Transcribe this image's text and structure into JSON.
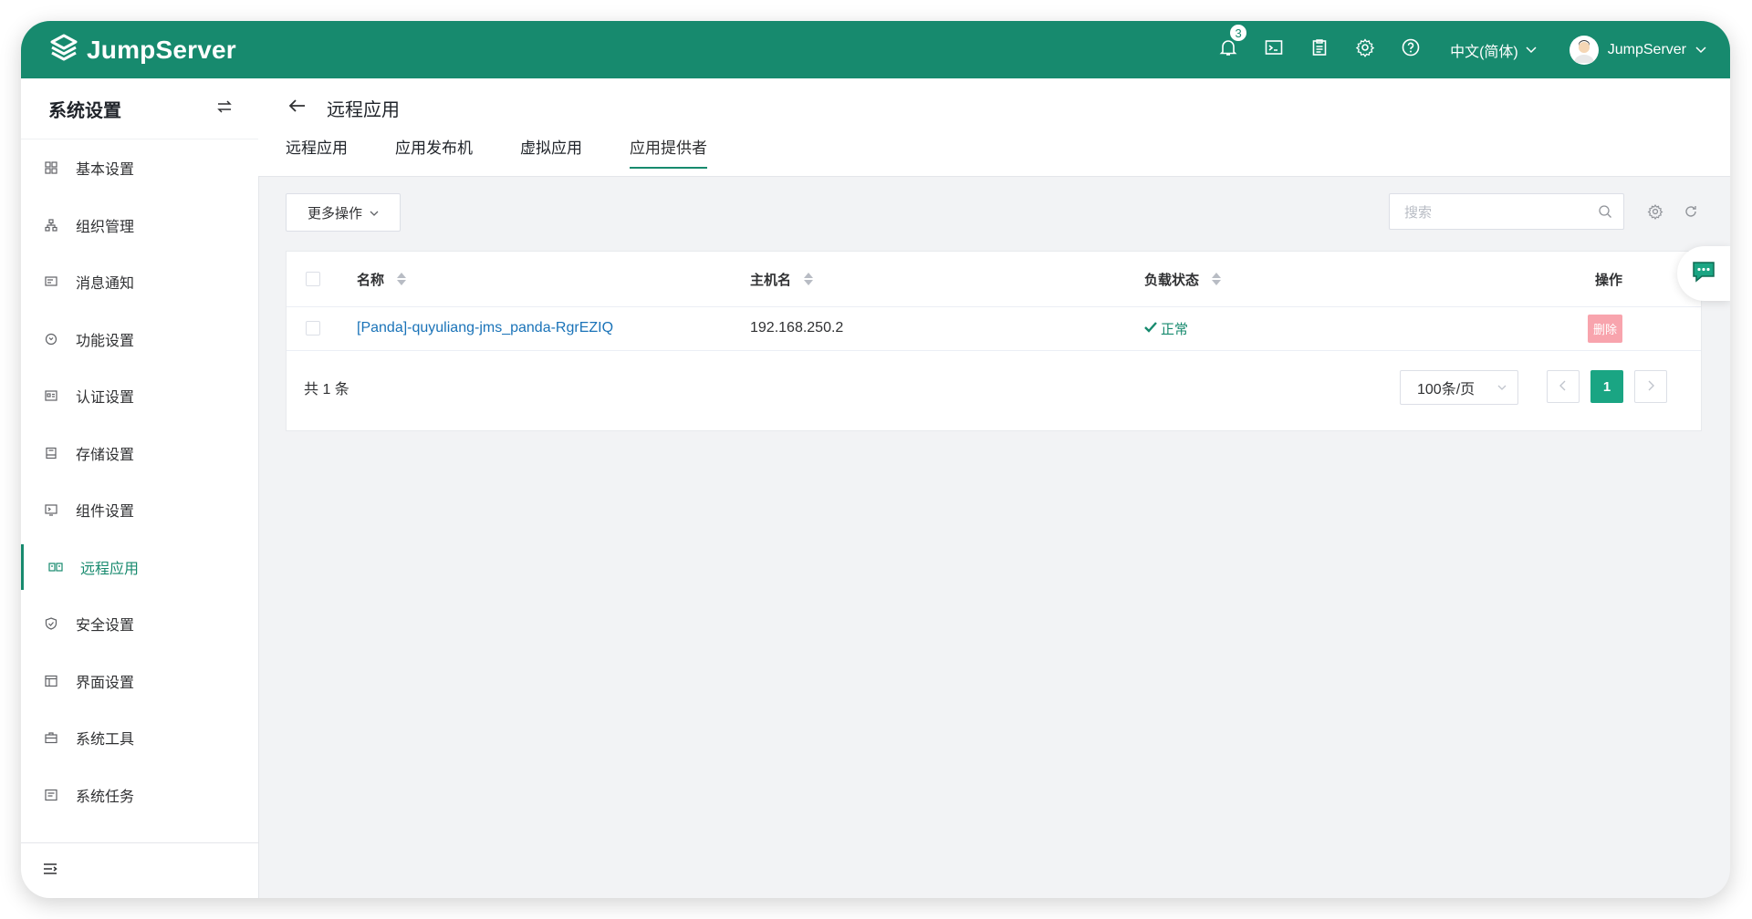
{
  "header": {
    "logo_text": "JumpServer",
    "notification_count": "3",
    "language": "中文(简体)",
    "username": "JumpServer",
    "icons": [
      "bell-icon",
      "terminal-icon",
      "clipboard-icon",
      "gear-icon",
      "help-icon"
    ],
    "bg_color": "#178a6e"
  },
  "sidebar": {
    "title": "系统设置",
    "items": [
      {
        "label": "基本设置",
        "icon": "grid-icon"
      },
      {
        "label": "组织管理",
        "icon": "org-icon"
      },
      {
        "label": "消息通知",
        "icon": "message-icon"
      },
      {
        "label": "功能设置",
        "icon": "feature-icon"
      },
      {
        "label": "认证设置",
        "icon": "id-card-icon"
      },
      {
        "label": "存储设置",
        "icon": "storage-icon"
      },
      {
        "label": "组件设置",
        "icon": "component-icon"
      },
      {
        "label": "远程应用",
        "icon": "remote-app-icon",
        "active": true
      },
      {
        "label": "安全设置",
        "icon": "shield-icon"
      },
      {
        "label": "界面设置",
        "icon": "interface-icon"
      },
      {
        "label": "系统工具",
        "icon": "toolbox-icon"
      },
      {
        "label": "系统任务",
        "icon": "task-icon"
      }
    ]
  },
  "page": {
    "title": "远程应用",
    "tabs": [
      "远程应用",
      "应用发布机",
      "虚拟应用",
      "应用提供者"
    ],
    "active_tab": "应用提供者"
  },
  "toolbar": {
    "more_actions": "更多操作",
    "search_placeholder": "搜索"
  },
  "table": {
    "columns": [
      "名称",
      "主机名",
      "负载状态",
      "操作"
    ],
    "rows": [
      {
        "name": "[Panda]-quyuliang-jms_panda-RgrEZIQ",
        "hostname": "192.168.250.2",
        "status": "正常",
        "action": "删除"
      }
    ],
    "total_text": "共 1 条",
    "page_size": "100条/页",
    "current_page": "1"
  }
}
